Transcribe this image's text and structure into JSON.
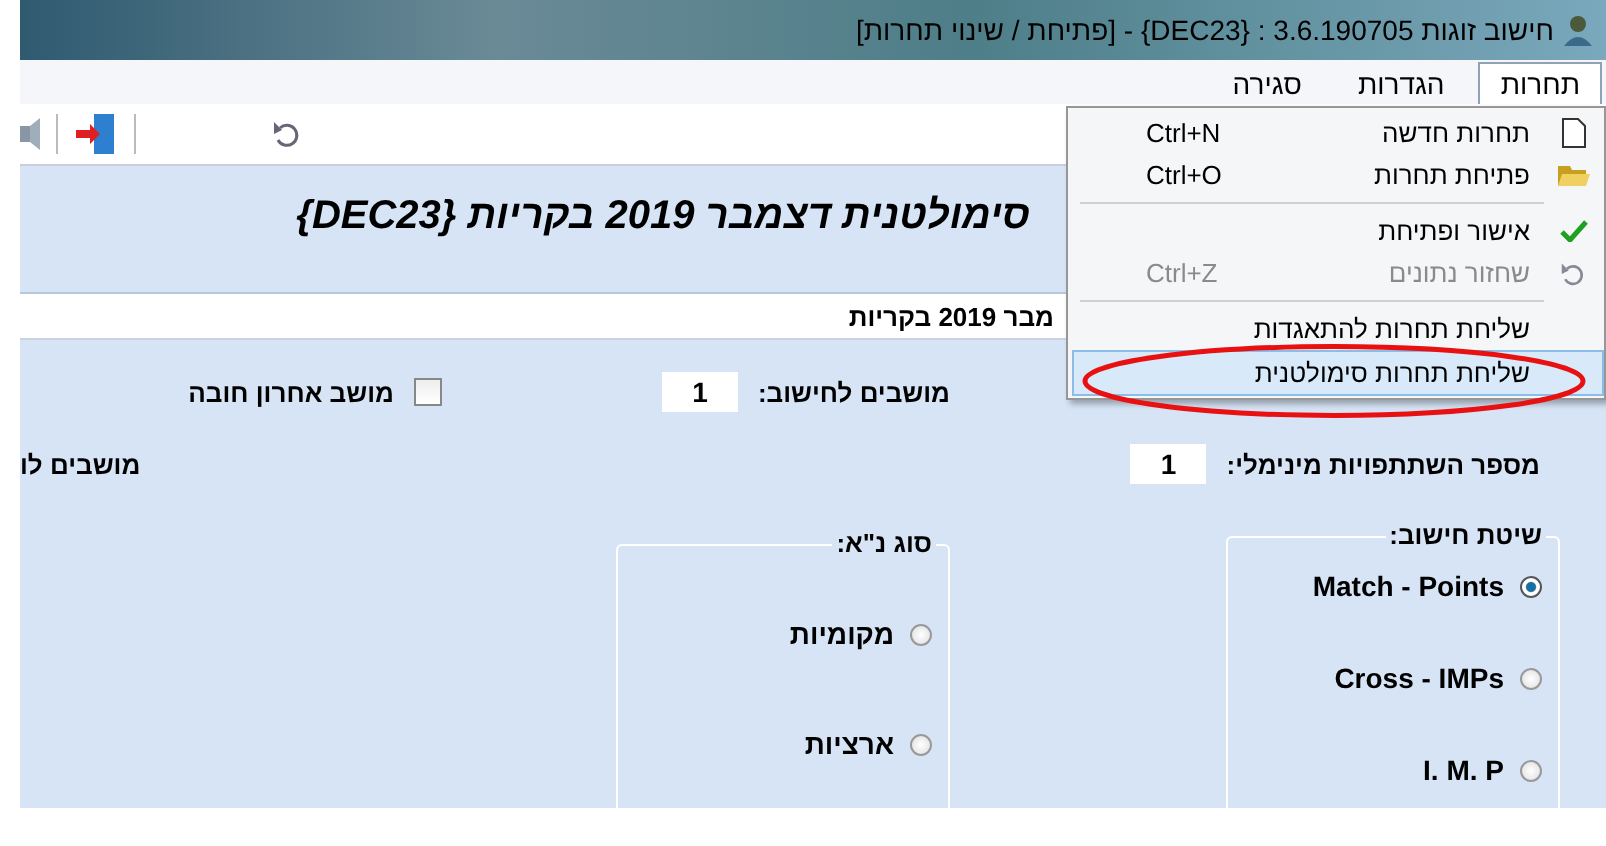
{
  "window": {
    "title": "חישוב זוגות 3.6.190705 : {DEC23} - [פתיחת / שינוי תחרות]"
  },
  "menubar": [
    {
      "label": "תחרות",
      "selected": true
    },
    {
      "label": "הגדרות",
      "selected": false
    },
    {
      "label": "סגירה",
      "selected": false
    }
  ],
  "header": {
    "title": "סימולטנית דצמבר 2019 בקריות {DEC23}",
    "subtitle": "מבר 2019 בקריות"
  },
  "fields": [
    {
      "label": "מושבים לחישוב:",
      "value": "1"
    },
    {
      "label": "מספר השתתפויות מינימלי:",
      "value": "1"
    }
  ],
  "checkbox": {
    "label": "מושב אחרון חובה",
    "checked": false
  },
  "cut_label": "מושבים לו",
  "groups": [
    {
      "title": "שיטת חישוב:",
      "options": [
        {
          "label": "Match - Points",
          "selected": true
        },
        {
          "label": "Cross - IMPs",
          "selected": false
        },
        {
          "label": "I. M. P",
          "selected": false
        }
      ]
    },
    {
      "title": "סוג נ\"א:",
      "options": [
        {
          "label": "מקומיות",
          "selected": false
        },
        {
          "label": "ארציות",
          "selected": false
        }
      ]
    }
  ],
  "menu": [
    {
      "kind": "item",
      "label": "תחרות חדשה",
      "shortcut": "Ctrl+N",
      "disabled": false,
      "highlighted": false
    },
    {
      "kind": "item",
      "label": "פתיחת תחרות",
      "shortcut": "Ctrl+O",
      "disabled": false,
      "highlighted": false
    },
    {
      "kind": "separator"
    },
    {
      "kind": "item",
      "label": "אישור ופתיחת",
      "disabled": false,
      "highlighted": false
    },
    {
      "kind": "item",
      "label": "שחזור נתונים",
      "shortcut": "Ctrl+Z",
      "disabled": true,
      "highlighted": false
    },
    {
      "kind": "separator"
    },
    {
      "kind": "item",
      "label": "שליחת תחרות להתאגדות",
      "disabled": false,
      "highlighted": false
    },
    {
      "kind": "item",
      "label": "שליחת תחרות סימולטנית",
      "disabled": false,
      "highlighted": true
    }
  ]
}
